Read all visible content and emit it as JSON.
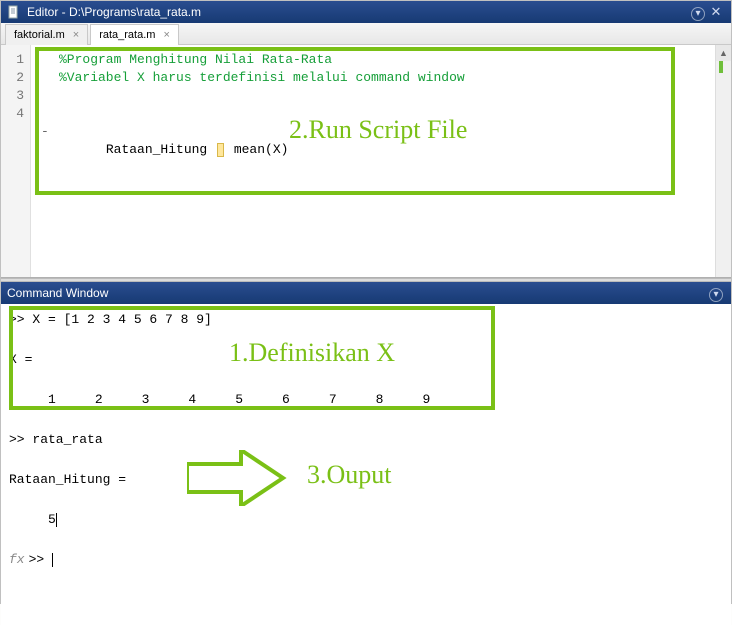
{
  "editor": {
    "title": "Editor - D:\\Programs\\rata_rata.m",
    "tabs": [
      {
        "label": "faktorial.m"
      },
      {
        "label": "rata_rata.m"
      }
    ],
    "gutter": [
      "1",
      "2",
      "3",
      "4"
    ],
    "line4dash": "-",
    "code": {
      "l1": "%Program Menghitung Nilai Rata-Rata",
      "l2": "%Variabel X harus terdefinisi melalui command window",
      "l4a": "Rataan_Hitung ",
      "l4b": " mean(X)"
    }
  },
  "command": {
    "title": "Command Window",
    "l1": ">> X = [1 2 3 4 5 6 7 8 9]",
    "l2": "X =",
    "l3": "     1     2     3     4     5     6     7     8     9",
    "l4": ">> rata_rata",
    "l5": "Rataan_Hitung =",
    "l6": "     5",
    "prompt": ">> ",
    "fx": "fx"
  },
  "annotations": {
    "a1": "1.Definisikan X",
    "a2": "2.Run Script File",
    "a3": "3.Ouput"
  }
}
